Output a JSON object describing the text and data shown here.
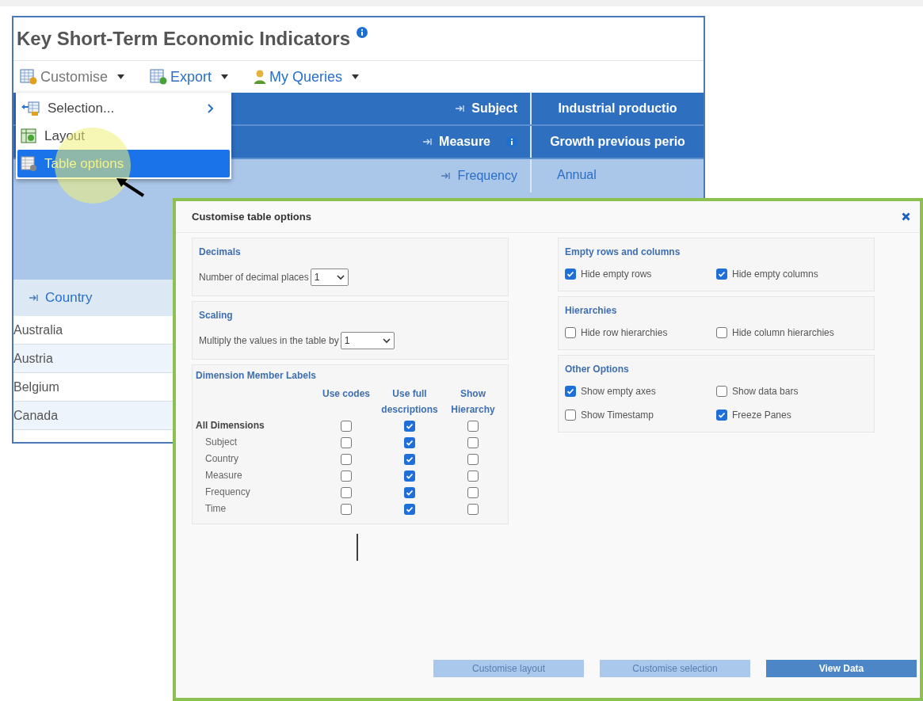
{
  "page": {
    "title": "Key Short-Term Economic Indicators",
    "info": true
  },
  "toolbar": [
    {
      "label": "Customise",
      "kind": "customise"
    },
    {
      "label": "Export",
      "kind": "export"
    },
    {
      "label": "My Queries",
      "kind": "queries"
    }
  ],
  "menu": [
    {
      "label": "Selection...",
      "kind": "selection",
      "submenu": true,
      "selected": false
    },
    {
      "label": "Layout",
      "kind": "layout",
      "submenu": false,
      "selected": false
    },
    {
      "label": "Table options",
      "kind": "table",
      "submenu": false,
      "selected": true
    }
  ],
  "table": {
    "header_rows": [
      {
        "label": "Subject",
        "value": "Industrial productio",
        "info": false,
        "kind": "dark"
      },
      {
        "label": "Measure",
        "value": "Growth previous perio",
        "info": true,
        "kind": "dark"
      },
      {
        "label": "Frequency",
        "value": "Annual",
        "info": false,
        "kind": "light"
      }
    ],
    "row_header": "Country",
    "rows": [
      "Australia",
      "Austria",
      "Belgium",
      "Canada"
    ]
  },
  "dialog": {
    "title": "Customise table options",
    "decimals": {
      "title": "Decimals",
      "label": "Number of decimal places",
      "value": "1"
    },
    "scaling": {
      "title": "Scaling",
      "label": "Multiply the values in the table by",
      "value": "1"
    },
    "dimension_labels": {
      "title": "Dimension Member Labels",
      "columns": [
        "Use codes",
        "Use full descriptions",
        "Show Hierarchy"
      ],
      "rows": [
        {
          "label": "All Dimensions",
          "bold": true,
          "checks": [
            false,
            true,
            false
          ]
        },
        {
          "label": "Subject",
          "bold": false,
          "checks": [
            false,
            true,
            false
          ]
        },
        {
          "label": "Country",
          "bold": false,
          "checks": [
            false,
            true,
            false
          ]
        },
        {
          "label": "Measure",
          "bold": false,
          "checks": [
            false,
            true,
            false
          ]
        },
        {
          "label": "Frequency",
          "bold": false,
          "checks": [
            false,
            true,
            false
          ]
        },
        {
          "label": "Time",
          "bold": false,
          "checks": [
            false,
            true,
            false
          ]
        }
      ]
    },
    "option_groups": [
      {
        "title": "Empty rows and columns",
        "options": [
          {
            "label": "Hide empty rows",
            "checked": true
          },
          {
            "label": "Hide empty columns",
            "checked": true
          }
        ]
      },
      {
        "title": "Hierarchies",
        "options": [
          {
            "label": "Hide row hierarchies",
            "checked": false
          },
          {
            "label": "Hide column hierarchies",
            "checked": false
          }
        ]
      },
      {
        "title": "Other Options",
        "options": [
          {
            "label": "Show empty axes",
            "checked": true
          },
          {
            "label": "Show data bars",
            "checked": false
          },
          {
            "label": "Show Timestamp",
            "checked": false
          },
          {
            "label": "Freeze Panes",
            "checked": true
          }
        ]
      }
    ],
    "buttons": [
      {
        "label": "Customise layout",
        "primary": false
      },
      {
        "label": "Customise selection",
        "primary": false
      },
      {
        "label": "View Data",
        "primary": true
      }
    ]
  }
}
